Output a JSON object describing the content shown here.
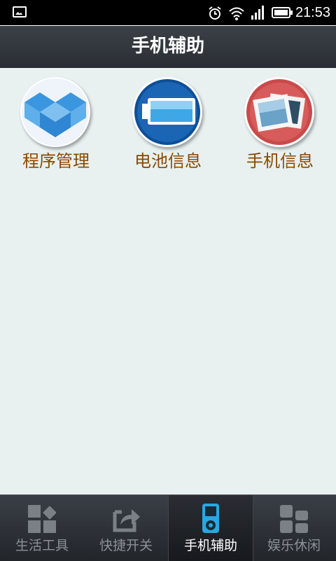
{
  "status": {
    "time": "21:53"
  },
  "header": {
    "title": "手机辅助"
  },
  "grid": {
    "items": [
      {
        "label": "程序管理",
        "icon": "dropbox-box-icon"
      },
      {
        "label": "电池信息",
        "icon": "battery-icon"
      },
      {
        "label": "手机信息",
        "icon": "photo-frames-icon"
      }
    ]
  },
  "tabs": [
    {
      "label": "生活工具",
      "icon": "shapes-icon",
      "active": false
    },
    {
      "label": "快捷开关",
      "icon": "share-arrow-icon",
      "active": false
    },
    {
      "label": "手机辅助",
      "icon": "phone-ipod-icon",
      "active": true
    },
    {
      "label": "娱乐休闲",
      "icon": "tiles-icon",
      "active": false
    }
  ],
  "colors": {
    "label": "#8a4a00",
    "accent": "#29a8e0",
    "background": "#e8f0f0"
  }
}
